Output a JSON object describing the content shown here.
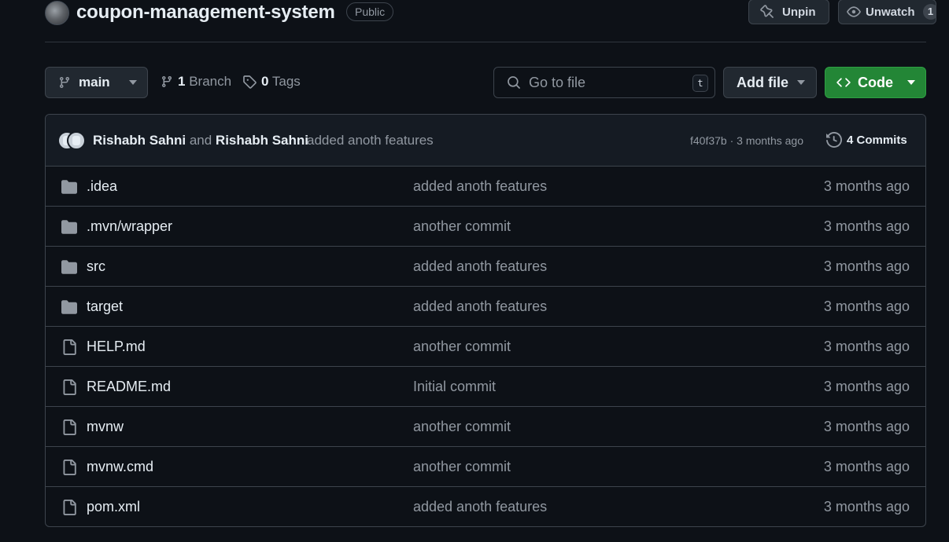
{
  "repo": {
    "name": "coupon-management-system",
    "visibility": "Public"
  },
  "header_actions": {
    "unpin_label": "Unpin",
    "unwatch_label": "Unwatch",
    "watch_count": "1"
  },
  "toolbar": {
    "branch": "main",
    "branch_count": "1",
    "branch_label": "Branch",
    "tag_count": "0",
    "tag_label": "Tags",
    "goto_placeholder": "Go to file",
    "goto_shortcut": "t",
    "add_file_label": "Add file",
    "code_label": "Code"
  },
  "commit": {
    "author1": "Rishabh Sahni",
    "joiner": "and",
    "author2": "Rishabh Sahni",
    "message": "added anoth features",
    "hash_and_time": "f40f37b · 3 months ago",
    "commits_label": "4 Commits"
  },
  "files": [
    {
      "name": ".idea",
      "type": "folder",
      "commit": "added anoth features",
      "date": "3 months ago"
    },
    {
      "name": ".mvn/wrapper",
      "type": "folder",
      "commit": "another commit",
      "date": "3 months ago"
    },
    {
      "name": "src",
      "type": "folder",
      "commit": "added anoth features",
      "date": "3 months ago"
    },
    {
      "name": "target",
      "type": "folder",
      "commit": "added anoth features",
      "date": "3 months ago"
    },
    {
      "name": "HELP.md",
      "type": "file",
      "commit": "another commit",
      "date": "3 months ago"
    },
    {
      "name": "README.md",
      "type": "file",
      "commit": "Initial commit",
      "date": "3 months ago"
    },
    {
      "name": "mvnw",
      "type": "file",
      "commit": "another commit",
      "date": "3 months ago"
    },
    {
      "name": "mvnw.cmd",
      "type": "file",
      "commit": "another commit",
      "date": "3 months ago"
    },
    {
      "name": "pom.xml",
      "type": "file",
      "commit": "added anoth features",
      "date": "3 months ago"
    }
  ],
  "icons": {
    "folder": "folder-icon",
    "file": "file-icon"
  },
  "colors": {
    "background": "#0d1117",
    "primary_button": "#238636",
    "border": "#3d444d",
    "muted_text": "#9198a1"
  }
}
